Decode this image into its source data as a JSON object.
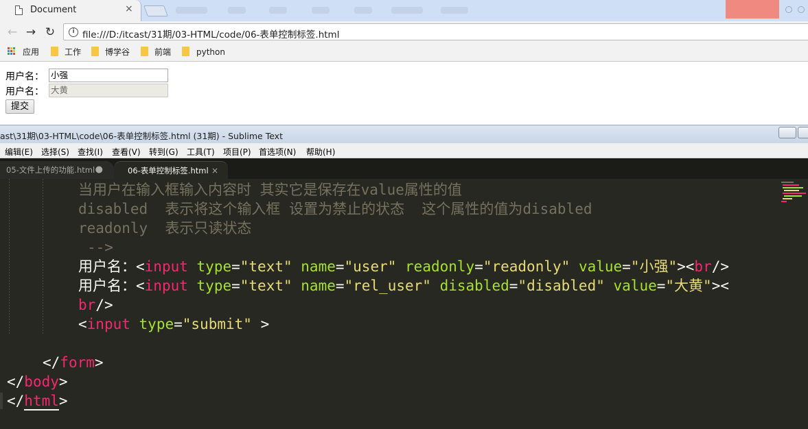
{
  "browser": {
    "tab_title": "Document",
    "tab_close": "×",
    "url": "file:///D:/itcast/31期/03-HTML/code/06-表单控制标签.html",
    "nav": {
      "back": "←",
      "forward": "→",
      "reload": "↻"
    },
    "bookmarks": [
      "应用",
      "工作",
      "博学谷",
      "前端",
      "python"
    ]
  },
  "page": {
    "rows": [
      {
        "label": "用户名：",
        "value": "小强"
      },
      {
        "label": "用户名：",
        "value": "大黄"
      }
    ],
    "submit_label": "提交"
  },
  "editor": {
    "window_title": "ast\\31期\\03-HTML\\code\\06-表单控制标签.html (31期) - Sublime Text",
    "menu": [
      "编辑(E)",
      "选择(S)",
      "查找(I)",
      "查看(V)",
      "转到(G)",
      "工具(T)",
      "项目(P)",
      "首选项(N)",
      "帮助(H)"
    ],
    "tabs": [
      {
        "label": "05-文件上传的功能.html",
        "marker": "●"
      },
      {
        "label": "06-表单控制标签.html",
        "marker": "×"
      }
    ],
    "code": {
      "l1": "当用户在输入框输入内容时 其实它是保存在value属性的值",
      "l2": "disabled  表示将这个输入框 设置为禁止的状态  这个属性的值为disabled",
      "l3": "readonly  表示只读状态",
      "l4": "-->",
      "l5": {
        "text": "用户名：",
        "lt": "<",
        "tag": "input",
        "a1": "type",
        "v1": "\"text\"",
        "a2": "name",
        "v2": "\"user\"",
        "a3": "readonly",
        "v3": "\"readonly\"",
        "a4": "value",
        "v4": "\"小强\"",
        "gt": ">",
        "br_open": "<",
        "br": "br",
        "br_close": "/>"
      },
      "l6": {
        "text": "用户名：",
        "lt": "<",
        "tag": "input",
        "a1": "type",
        "v1": "\"text\"",
        "a2": "name",
        "v2": "\"rel_user\"",
        "a3": "disabled",
        "v3": "\"disabled\"",
        "a4": "value",
        "v4": "\"大黄\"",
        "gt": "><"
      },
      "l7": {
        "tag": "br",
        "close": "/>"
      },
      "l8": {
        "lt": "<",
        "tag": "input",
        "a1": "type",
        "v1": "\"submit\"",
        "gt": " >"
      },
      "l10": {
        "lt": "</",
        "tag": "form",
        "gt": ">"
      },
      "l11": {
        "lt": "</",
        "tag": "body",
        "gt": ">"
      },
      "l12": {
        "lt": "</",
        "tag": "html",
        "gt": ">"
      }
    }
  },
  "colors": {
    "editor_bg": "#272822",
    "comment": "#75715e",
    "tag": "#f92672",
    "attribute": "#a6e22e",
    "string": "#e6db74"
  }
}
